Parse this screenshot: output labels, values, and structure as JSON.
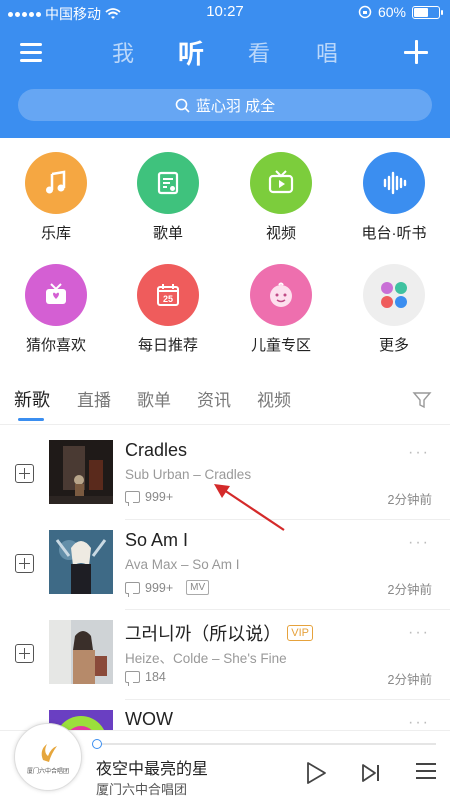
{
  "status_bar": {
    "carrier": "中国移动",
    "time": "10:27",
    "battery": "60%",
    "battery_level": 0.6
  },
  "nav": {
    "tabs": [
      "我",
      "听",
      "看",
      "唱"
    ],
    "active_tab": "听"
  },
  "search": {
    "placeholder": "蓝心羽 成全"
  },
  "categories": [
    {
      "label": "乐库",
      "color": "#f5a742",
      "icon": "music-note-icon"
    },
    {
      "label": "歌单",
      "color": "#3fc27d",
      "icon": "playlist-icon"
    },
    {
      "label": "视频",
      "color": "#7ccd3c",
      "icon": "tv-icon"
    },
    {
      "label": "电台·听书",
      "color": "#3b8ef0",
      "icon": "soundwave-icon"
    },
    {
      "label": "猜你喜欢",
      "color": "#d45fd3",
      "icon": "heart-radio-icon"
    },
    {
      "label": "每日推荐",
      "color": "#ef5c5c",
      "icon": "calendar-icon",
      "badge": "25"
    },
    {
      "label": "儿童专区",
      "color": "#ee6fae",
      "icon": "baby-face-icon"
    },
    {
      "label": "更多",
      "color": "#eeeeee",
      "icon": "more-grid-icon"
    }
  ],
  "sub_tabs": [
    "新歌",
    "直播",
    "歌单",
    "资讯",
    "视频"
  ],
  "songs": [
    {
      "title": "Cradles",
      "subtitle": "Sub Urban – Cradles",
      "comments": "999+",
      "time": "2分钟前"
    },
    {
      "title": "So Am I",
      "subtitle": "Ava Max – So Am I",
      "comments": "999+",
      "mv": "MV",
      "time": "2分钟前"
    },
    {
      "title": "그러니까（所以说）",
      "vip": "VIP",
      "subtitle": "Heize、Colde – She's Fine",
      "comments": "184",
      "time": "2分钟前"
    },
    {
      "title": "WOW"
    }
  ],
  "player": {
    "title": "夜空中最亮的星",
    "artist": "厦门六中合唱团",
    "disc_caption": "厦门六中合唱团",
    "progress": 0.0
  },
  "colors": {
    "accent": "#3b8ef0"
  }
}
